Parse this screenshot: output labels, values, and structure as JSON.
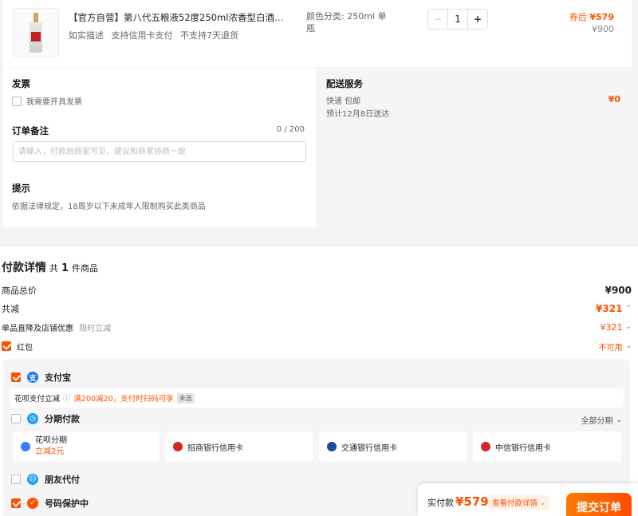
{
  "product": {
    "title": "【官方自营】第八代五粮液52度250ml浓香型白酒收...",
    "tags": [
      "如实描述",
      "支持信用卡支付",
      "不支持7天退货"
    ],
    "spec": "颜色分类: 250ml 单瓶",
    "quantity": "1",
    "minus": "−",
    "plus": "+",
    "after_label": "券后",
    "after_price": "¥579",
    "orig_price": "¥900"
  },
  "invoice": {
    "title": "发票",
    "checkbox_label": "我需要开具发票"
  },
  "remark": {
    "title": "订单备注",
    "count": "0 / 200",
    "placeholder": "请输入，付款后商家可见，建议和商家协商一致"
  },
  "tip": {
    "title": "提示",
    "text": "依据法律规定，18周岁以下未成年人限制购买此类商品"
  },
  "delivery": {
    "title": "配送服务",
    "method": "快递 包邮",
    "eta": "预计12月8日送达",
    "fee": "¥0"
  },
  "payment": {
    "title": "付款详情",
    "count_prefix": "共",
    "count": "1",
    "count_suffix": "件商品",
    "total_label": "商品总价",
    "total_value": "¥900",
    "discount_label": "共减",
    "discount_value": "¥321",
    "promo_label": "单品直降及店铺优惠",
    "promo_tag": "限时立减",
    "promo_value": "¥321",
    "redpacket_label": "红包",
    "redpacket_value": "不可用"
  },
  "methods": {
    "alipay": "支付宝",
    "huabei_label": "花呗支付立减",
    "huabei_promo": "满200减20，支付时扫码可享",
    "huabei_badge": "未选",
    "installment": "分期付款",
    "installment_all": "全部分期",
    "cards": [
      {
        "name": "花呗分期",
        "sub": "立减2元",
        "color": "#3b7cff"
      },
      {
        "name": "招商银行信用卡",
        "color": "#d7262a"
      },
      {
        "name": "交通银行信用卡",
        "color": "#1c4a9c"
      },
      {
        "name": "中信银行信用卡",
        "color": "#d7262a"
      }
    ],
    "friend_pay": "朋友代付",
    "privacy": "号码保护中"
  },
  "bottom": {
    "pay_label": "实付款",
    "pay_value": "¥579",
    "detail_link": "查看付款详情",
    "submit": "提交订单"
  },
  "colors": {
    "accent": "#ff5000",
    "alipay_blue": "#1677ff"
  }
}
